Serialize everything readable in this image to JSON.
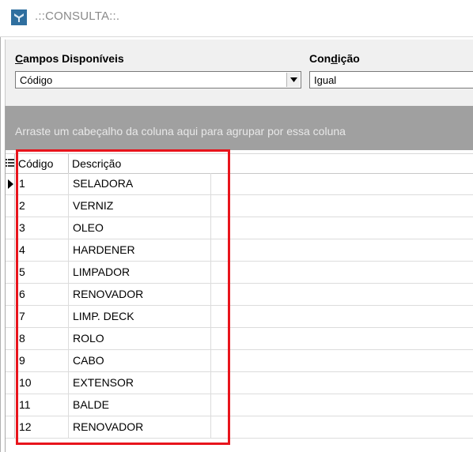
{
  "window": {
    "title": ".::CONSULTA::.",
    "icon": "app-logo-icon",
    "accent": "#2f6f9f"
  },
  "filter": {
    "fields_label_prefix": "",
    "fields_label_underlined": "C",
    "fields_label_rest": "ampos Disponíveis",
    "fields_value": "Código",
    "condition_label_prefix": "Con",
    "condition_label_underlined": "d",
    "condition_label_rest": "ição",
    "condition_value": "Igual"
  },
  "grid": {
    "group_hint": "Arraste um cabeçalho da coluna aqui para agrupar por essa coluna",
    "columns": [
      "Código",
      "Descrição"
    ],
    "rows": [
      {
        "codigo": "1",
        "descricao": "SELADORA"
      },
      {
        "codigo": "2",
        "descricao": "VERNIZ"
      },
      {
        "codigo": "3",
        "descricao": "OLEO"
      },
      {
        "codigo": "4",
        "descricao": "HARDENER"
      },
      {
        "codigo": "5",
        "descricao": "LIMPADOR"
      },
      {
        "codigo": "6",
        "descricao": "RENOVADOR"
      },
      {
        "codigo": "7",
        "descricao": "LIMP. DECK"
      },
      {
        "codigo": "8",
        "descricao": "ROLO"
      },
      {
        "codigo": "9",
        "descricao": "CABO"
      },
      {
        "codigo": "10",
        "descricao": "EXTENSOR"
      },
      {
        "codigo": "11",
        "descricao": "BALDE"
      },
      {
        "codigo": "12",
        "descricao": "RENOVADOR"
      }
    ],
    "selected_row": 0,
    "highlight_color": "#e8141c"
  }
}
